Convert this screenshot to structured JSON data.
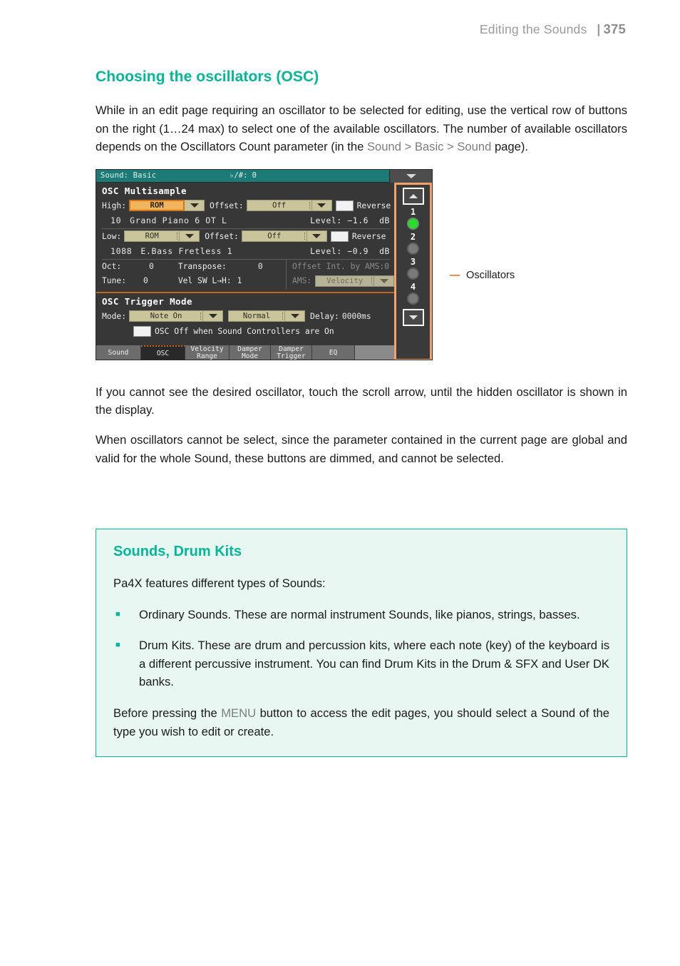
{
  "header": {
    "chapter": "Editing the Sounds",
    "folio_separator": "|",
    "page_number": "375"
  },
  "section": {
    "title": "Choosing the oscillators (OSC)",
    "intro_part1": "While in an edit page requiring an oscillator to be selected for editing, use the vertical row of buttons on the right (1…24 max) to select one of the available oscillators. The number of available oscillators depends on the Oscillators Count parameter (in the ",
    "intro_path": "Sound > Basic > Sound",
    "intro_part2": " page).",
    "para_scroll": "If you cannot see the desired oscillator, touch the scroll arrow, until the hidden oscillator is shown in the display.",
    "para_dimmed": "When oscillators cannot be select, since the parameter contained in the current page are global and valid for the whole Sound, these buttons are dimmed, and cannot be selected."
  },
  "figure": {
    "callout_label": "Oscillators",
    "lcd": {
      "titlebar": {
        "page_name": "Sound: Basic",
        "key_transpose": "♭/#: 0"
      },
      "panel_multisample": {
        "title": "OSC Multisample",
        "high": {
          "label": "High:",
          "source": "ROM",
          "offset_label": "Offset:",
          "offset_value": "Off",
          "reverse_label": "Reverse",
          "sample_number": "10",
          "sample_name": "Grand Piano 6 OT L",
          "level_label": "Level:",
          "level_value": "−1.6",
          "level_unit": "dB"
        },
        "low": {
          "label": "Low:",
          "source": "ROM",
          "offset_label": "Offset:",
          "offset_value": "Off",
          "reverse_label": "Reverse",
          "sample_number": "1088",
          "sample_name": "E.Bass Fretless 1",
          "level_label": "Level:",
          "level_value": "−0.9",
          "level_unit": "dB"
        },
        "oct_label": "Oct:",
        "oct_value": "0",
        "transpose_label": "Transpose:",
        "transpose_value": "0",
        "tune_label": "Tune:",
        "tune_value": "0",
        "velsw_label": "Vel SW L→H:",
        "velsw_value": "1",
        "offset_int_ams": "Offset Int. by AMS:0",
        "ams_label": "AMS:",
        "ams_value": "Velocity"
      },
      "panel_trigger": {
        "title": "OSC Trigger Mode",
        "mode_label": "Mode:",
        "mode_value": "Note On",
        "mode_value2": "Normal",
        "delay_label": "Delay:",
        "delay_value": "0000ms",
        "osc_off_label": "OSC Off when Sound Controllers are On"
      },
      "osc_selector": {
        "items": [
          {
            "number": "1",
            "active": true
          },
          {
            "number": "2",
            "active": false
          },
          {
            "number": "3",
            "active": false
          },
          {
            "number": "4",
            "active": false
          }
        ]
      },
      "tabs": [
        {
          "label": "Sound",
          "active": false
        },
        {
          "label": "OSC",
          "active": true
        },
        {
          "label": "Velocity\nRange",
          "active": false
        },
        {
          "label": "Damper\nMode",
          "active": false
        },
        {
          "label": "Damper\nTrigger",
          "active": false
        },
        {
          "label": "EQ",
          "active": false
        },
        {
          "label": "",
          "active": false
        }
      ]
    }
  },
  "tipbox": {
    "title": "Sounds, Drum Kits",
    "intro": "Pa4X features different types of Sounds:",
    "bullets": [
      "Ordinary Sounds. These are normal instrument Sounds, like pianos, strings, basses.",
      "Drum Kits. These are drum and percussion kits, where each note (key) of the keyboard is a different percussive instrument. You can find Drum Kits in the Drum & SFX and User DK banks."
    ],
    "closing_part1": "Before pressing the ",
    "closing_menu": "MENU",
    "closing_part2": " button to access the edit pages, you should select a Sound of the type you wish to edit or create."
  },
  "colors": {
    "accent_teal": "#00b894",
    "highlight_orange": "#f5a26a",
    "lcd_titlebar": "#1d7b77",
    "led_on": "#25e028"
  }
}
